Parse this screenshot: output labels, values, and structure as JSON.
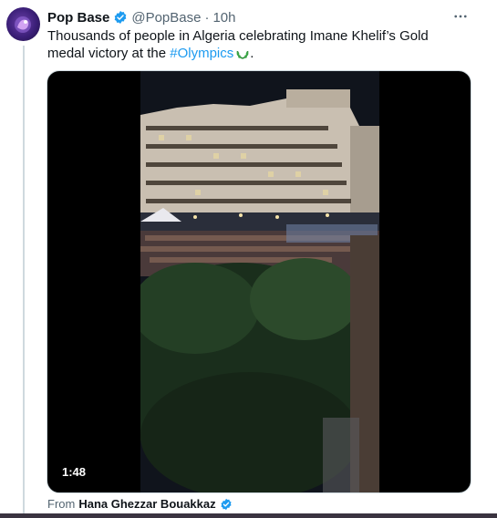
{
  "tweet": {
    "author_name": "Pop Base",
    "handle": "@PopBase",
    "separator": "·",
    "time": "10h",
    "text_before": "Thousands of people in Algeria celebrating Imane Khelif’s Gold medal victory at the ",
    "hashtag": "#Olympics",
    "text_after": ".",
    "emoji_icon": "olympic-laurel-emoji",
    "more_icon": "more-dots-icon",
    "verified_color": "#1d9bf0"
  },
  "video": {
    "duration": "1:48",
    "scene": "night-street-crowd-video-frame"
  },
  "attribution": {
    "prefix": "From",
    "source_name": "Hana Ghezzar Bouakkaz"
  },
  "colors": {
    "accent": "#1d9bf0",
    "secondary_text": "#536471"
  }
}
